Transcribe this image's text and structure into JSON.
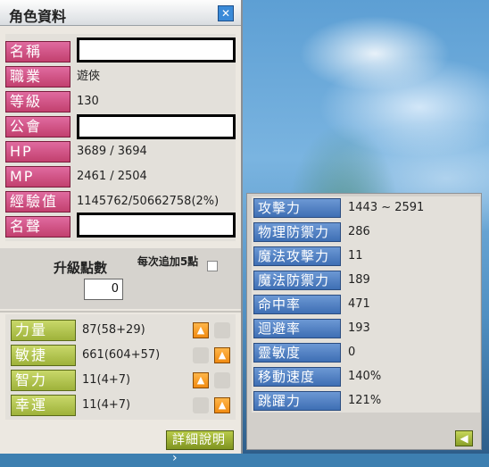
{
  "window": {
    "title": "角色資料"
  },
  "icons": {
    "close": "close-icon",
    "up_arrow": "arrow-up-icon",
    "back_arrow": "arrow-left-icon"
  },
  "info": {
    "name_label": "名稱",
    "name_value": "",
    "job_label": "職業",
    "job_value": "遊俠",
    "level_label": "等級",
    "level_value": "130",
    "guild_label": "公會",
    "guild_value": "",
    "hp_label": "HP",
    "hp_value": "3689 / 3694",
    "mp_label": "MP",
    "mp_value": "2461 / 2504",
    "exp_label": "經驗值",
    "exp_value": "1145762/50662758(2%)",
    "fame_label": "名聲",
    "fame_value": ""
  },
  "ability_points": {
    "label": "升級點數",
    "value": "0",
    "every_label": "每次追加5點"
  },
  "stats": [
    {
      "label": "力量",
      "value": "87(58+29)"
    },
    {
      "label": "敏捷",
      "value": "661(604+57)"
    },
    {
      "label": "智力",
      "value": "11(4+7)"
    },
    {
      "label": "幸運",
      "value": "11(4+7)"
    }
  ],
  "detail_button": "詳細說明",
  "detail_panel": [
    {
      "label": "攻擊力",
      "value": "1443 ~ 2591"
    },
    {
      "label": "物理防禦力",
      "value": "286"
    },
    {
      "label": "魔法攻擊力",
      "value": "11"
    },
    {
      "label": "魔法防禦力",
      "value": "189"
    },
    {
      "label": "命中率",
      "value": "471"
    },
    {
      "label": "迴避率",
      "value": "193"
    },
    {
      "label": "靈敏度",
      "value": "0"
    },
    {
      "label": "移動速度",
      "value": "140%"
    },
    {
      "label": "跳躍力",
      "value": "121%"
    }
  ]
}
